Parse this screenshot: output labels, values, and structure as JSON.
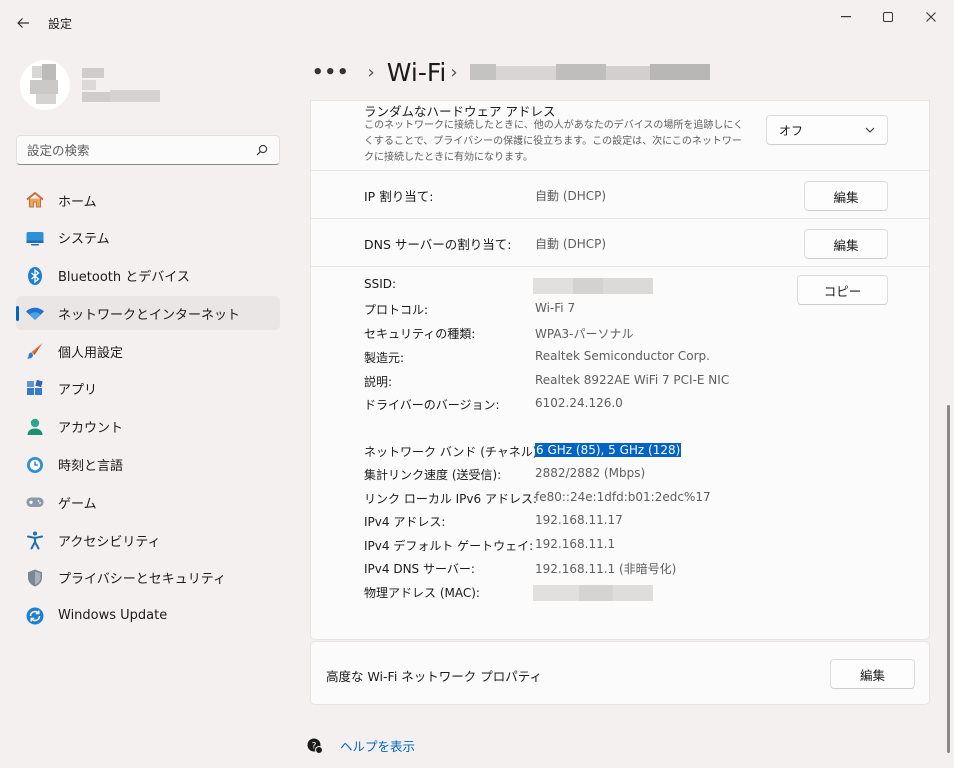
{
  "window": {
    "title": "設定",
    "minimize": "—",
    "close": "✕"
  },
  "search": {
    "placeholder": "設定の検索"
  },
  "nav": {
    "items": [
      {
        "label": "ホーム"
      },
      {
        "label": "システム"
      },
      {
        "label": "Bluetooth とデバイス"
      },
      {
        "label": "ネットワークとインターネット",
        "active": true
      },
      {
        "label": "個人用設定"
      },
      {
        "label": "アプリ"
      },
      {
        "label": "アカウント"
      },
      {
        "label": "時刻と言語"
      },
      {
        "label": "ゲーム"
      },
      {
        "label": "アクセシビリティ"
      },
      {
        "label": "プライバシーとセキュリティ"
      },
      {
        "label": "Windows Update"
      }
    ]
  },
  "breadcrumb": {
    "dots": "•••",
    "sep": "›",
    "page": "Wi-Fi"
  },
  "random_mac": {
    "title": "ランダムなハードウェア アドレス",
    "description": "このネットワークに接続したときに、他の人があなたのデバイスの場所を追跡しにくくすることで、プライバシーの保護に役立ちます。この設定は、次にこのネットワークに接続したときに有効になります。",
    "value": "オフ"
  },
  "ip_assignment": {
    "label": "IP 割り当て:",
    "value": "自動 (DHCP)",
    "button": "編集"
  },
  "dns_assignment": {
    "label": "DNS サーバーの割り当て:",
    "value": "自動 (DHCP)",
    "button": "編集"
  },
  "properties": {
    "copy_button": "コピー",
    "ssid_label": "SSID:",
    "protocol_label": "プロトコル:",
    "protocol": "Wi-Fi 7",
    "security_label": "セキュリティの種類:",
    "security": "WPA3-パーソナル",
    "manufacturer_label": "製造元:",
    "manufacturer": "Realtek Semiconductor Corp.",
    "description_label": "説明:",
    "description": "Realtek 8922AE WiFi 7 PCI-E NIC",
    "driver_label": "ドライバーのバージョン:",
    "driver": "6102.24.126.0",
    "band_label": "ネットワーク バンド (チャネル):",
    "band": "6 GHz (85), 5 GHz (128)",
    "link_speed_label": "集計リンク速度 (送受信):",
    "link_speed": "2882/2882 (Mbps)",
    "ipv6_label": "リンク ローカル IPv6 アドレス:",
    "ipv6": "fe80::24e:1dfd:b01:2edc%17",
    "ipv4_label": "IPv4 アドレス:",
    "ipv4": "192.168.11.17",
    "gateway_label": "IPv4 デフォルト ゲートウェイ:",
    "gateway": "192.168.11.1",
    "dns_label": "IPv4 DNS サーバー:",
    "dns": "192.168.11.1 (非暗号化)",
    "mac_label": "物理アドレス (MAC):"
  },
  "advanced": {
    "label": "高度な Wi-Fi ネットワーク プロパティ",
    "button": "編集"
  },
  "help": {
    "link": "ヘルプを表示"
  },
  "colors": {
    "accent": "#0067c0",
    "selection": "#0063c6",
    "background": "#f3f0ef",
    "card": "#fbfbfb"
  },
  "icons": [
    "back-arrow-icon",
    "search-icon",
    "home-icon",
    "system-icon",
    "bluetooth-icon",
    "wifi-icon",
    "personalization-icon",
    "apps-icon",
    "accounts-icon",
    "time-language-icon",
    "gaming-icon",
    "accessibility-icon",
    "privacy-shield-icon",
    "windows-update-icon",
    "chevron-down-icon",
    "help-icon"
  ]
}
